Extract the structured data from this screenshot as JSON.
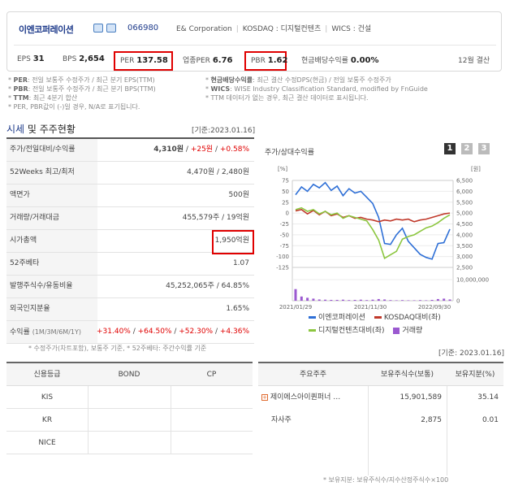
{
  "company": {
    "name": "이엔코퍼레이션",
    "code": "066980",
    "english_name": "E& Corporation",
    "market": "KOSDAQ : 디지털컨텐츠",
    "wics": "WICS : 건설"
  },
  "metrics": {
    "eps_label": "EPS",
    "eps_value": "31",
    "bps_label": "BPS",
    "bps_value": "2,654",
    "per_label": "PER",
    "per_value": "137.58",
    "sector_per_label": "업종PER",
    "sector_per_value": "6.76",
    "pbr_label": "PBR",
    "pbr_value": "1.62",
    "dividend_label": "현금배당수익률",
    "dividend_value": "0.00%",
    "settlement": "12월 결산"
  },
  "notes": {
    "left": [
      {
        "key": "PER",
        "text": ": 전일 보통주 수정주가 / 최근 분기 EPS(TTM)"
      },
      {
        "key": "PBR",
        "text": ": 전일 보통주 수정주가 / 최근 분기 BPS(TTM)"
      },
      {
        "key": "TTM",
        "text": ": 최근 4분기 합산"
      },
      {
        "key": "",
        "text": "PER, PBR값이 (-)일 경우, N/A로 표기됩니다."
      }
    ],
    "right": [
      {
        "key": "현금배당수익률",
        "text": ": 최근 결산 수정DPS(현금) / 전일 보통주 수정주가"
      },
      {
        "key": "WICS",
        "text": ": WISE Industry Classification Standard, modified by FnGuide"
      },
      {
        "key": "",
        "text": "TTM 데이터가 없는 경우, 최근 결산 데이터로 표시됩니다."
      }
    ]
  },
  "section": {
    "title_a": "시세",
    "title_b": " 및 주주현황",
    "date": "[기준:2023.01.16]"
  },
  "price_table": [
    {
      "label": "주가/전일대비/수익률",
      "v1": "4,310원",
      "v2": "+25원",
      "v3": "+0.58%"
    },
    {
      "label": "52Weeks 최고/최저",
      "value": "4,470원 / 2,480원"
    },
    {
      "label": "액면가",
      "value": "500원"
    },
    {
      "label": "거래량/거래대금",
      "value": "455,579주 / 19억원"
    },
    {
      "label": "시가총액",
      "value": "1,950억원"
    },
    {
      "label": "52주베타",
      "value": "1.07"
    },
    {
      "label": "발행주식수/유동비율",
      "value": "45,252,065주 / 64.85%"
    },
    {
      "label": "외국인지분율",
      "value": "1.65%"
    },
    {
      "label": "수익률",
      "sub": "(1M/3M/6M/1Y)",
      "r1": "+31.40%",
      "r2": "+64.50%",
      "r3": "+52.30%",
      "r4": "+4.36%"
    }
  ],
  "table_foot": "* 수정주가(차트포함), 보통주 기준,  * 52주베타: 주간수익률 기준",
  "chart_panel": {
    "title": "주가/상대수익률",
    "buttons": [
      "1",
      "2",
      "3"
    ],
    "active_button": "1"
  },
  "chart_data": {
    "type": "line",
    "left_axis_label": "[%]",
    "right_axis_label": "[원]",
    "left_ticks": [
      "75",
      "50",
      "25",
      "0",
      "-25",
      "-50",
      "-75",
      "-100",
      "-125"
    ],
    "right_ticks": [
      "6,500",
      "6,000",
      "5,500",
      "5,000",
      "4,500",
      "4,000",
      "3,500",
      "3,000",
      "2,500"
    ],
    "volume_tick": "10,000,000",
    "volume_zero": "0",
    "x_labels": [
      "2021/01/29",
      "2021/11/30",
      "2022/09/30"
    ],
    "ylim": [
      -125,
      75
    ],
    "series": [
      {
        "name": "이엔코퍼레이션",
        "color": "#2e6fd6",
        "values": [
          42,
          60,
          50,
          66,
          58,
          70,
          52,
          62,
          40,
          56,
          46,
          50,
          36,
          22,
          -10,
          -70,
          -72,
          -50,
          -35,
          -65,
          -80,
          -95,
          -102,
          -106,
          -70,
          -68,
          -37
        ]
      },
      {
        "name": "KOSDAQ대비(좌)",
        "color": "#c0392b",
        "values": [
          5,
          8,
          -2,
          6,
          -4,
          4,
          -6,
          -2,
          -10,
          -6,
          -12,
          -10,
          -14,
          -16,
          -20,
          -16,
          -18,
          -14,
          -16,
          -14,
          -20,
          -16,
          -14,
          -10,
          -6,
          -2,
          0
        ]
      },
      {
        "name": "디지털컨텐츠대비(좌)",
        "color": "#8cc63f",
        "values": [
          8,
          12,
          4,
          8,
          -2,
          4,
          -4,
          0,
          -12,
          -6,
          -10,
          -14,
          -18,
          -38,
          -62,
          -104,
          -96,
          -88,
          -60,
          -54,
          -50,
          -42,
          -34,
          -30,
          -22,
          -12,
          -4
        ]
      },
      {
        "name": "거래량",
        "color": "#9b59d0",
        "type": "bar",
        "values": [
          5.5,
          2,
          1.4,
          1,
          0.6,
          0.5,
          0.4,
          0.4,
          0.5,
          0.3,
          0.4,
          0.5,
          0.3,
          0.5,
          0.8,
          0.6,
          0.3,
          0.2,
          0.3,
          0.2,
          0.2,
          0.3,
          0.2,
          0.4,
          0.8,
          1.0,
          0.6
        ]
      }
    ]
  },
  "bottom_date": "[기준: 2023.01.16]",
  "credit": {
    "headers": [
      "신용등급",
      "BOND",
      "CP"
    ],
    "rows": [
      {
        "agency": "KIS",
        "bond": "",
        "cp": ""
      },
      {
        "agency": "KR",
        "bond": "",
        "cp": ""
      },
      {
        "agency": "NICE",
        "bond": "",
        "cp": ""
      }
    ]
  },
  "holders": {
    "headers": [
      "주요주주",
      "보유주식수(보통)",
      "보유지분(%)"
    ],
    "rows": [
      {
        "name": "제이에스아이퀀퍼너 …",
        "shares": "15,901,589",
        "pct": "35.14"
      },
      {
        "name": "자사주",
        "shares": "2,875",
        "pct": "0.01"
      }
    ],
    "note": "* 보유지분: 보유주식수/지수산정주식수×100"
  }
}
